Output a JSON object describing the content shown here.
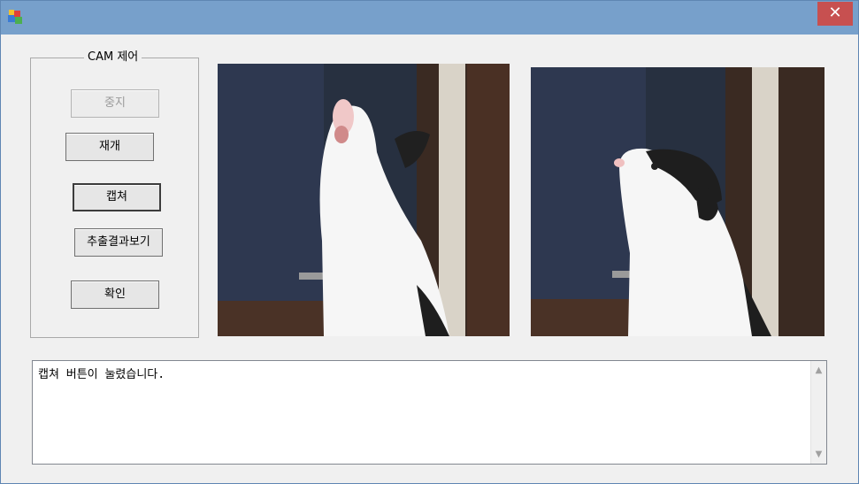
{
  "window": {
    "close_glyph": "✕"
  },
  "group": {
    "title": "CAM 제어"
  },
  "buttons": {
    "stop": "중지",
    "resume": "재개",
    "capture": "캡쳐",
    "view_result": "추출결과보기",
    "ok": "확인"
  },
  "log": {
    "text": "캡쳐 버튼이 눌렸습니다."
  },
  "icons": {
    "app": "app-icon",
    "close": "close-icon",
    "scroll_up": "chevron-up-icon",
    "scroll_down": "chevron-down-icon"
  }
}
